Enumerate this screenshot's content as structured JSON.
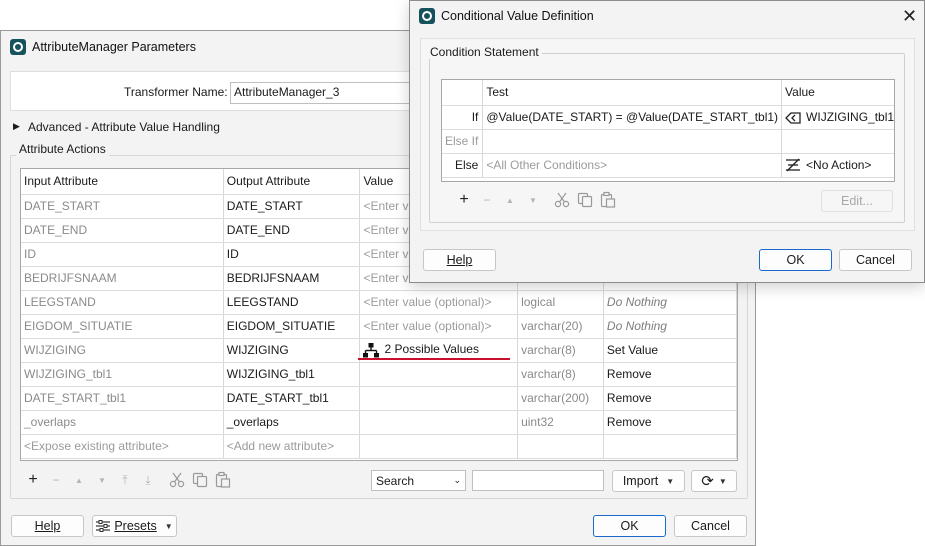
{
  "main_dialog": {
    "title": "AttributeManager Parameters",
    "transformer_name_label": "Transformer Name:",
    "transformer_name_value": "AttributeManager_3",
    "advanced_section": "Advanced - Attribute Value Handling",
    "attribute_actions_label": "Attribute Actions",
    "table": {
      "headers": [
        "Input Attribute",
        "Output Attribute",
        "Value",
        "",
        ""
      ],
      "rows": [
        {
          "input": "DATE_START",
          "output": "DATE_START",
          "value": "<Enter va",
          "type": "",
          "action": ""
        },
        {
          "input": "DATE_END",
          "output": "DATE_END",
          "value": "<Enter va",
          "type": "",
          "action": ""
        },
        {
          "input": "ID",
          "output": "ID",
          "value": "<Enter va",
          "type": "",
          "action": ""
        },
        {
          "input": "BEDRIJFSNAAM",
          "output": "BEDRIJFSNAAM",
          "value": "<Enter va",
          "type": "",
          "action": ""
        },
        {
          "input": "LEEGSTAND",
          "output": "LEEGSTAND",
          "value": "<Enter value (optional)>",
          "type": "logical",
          "action": "Do Nothing"
        },
        {
          "input": "EIGDOM_SITUATIE",
          "output": "EIGDOM_SITUATIE",
          "value": "<Enter value (optional)>",
          "type": "varchar(20)",
          "action": "Do Nothing"
        },
        {
          "input": "WIJZIGING",
          "output": "WIJZIGING",
          "value": "2 Possible Values",
          "type": "varchar(8)",
          "action": "Set Value"
        },
        {
          "input": "WIJZIGING_tbl1",
          "output": "WIJZIGING_tbl1",
          "value": "",
          "type": "varchar(8)",
          "action": "Remove"
        },
        {
          "input": "DATE_START_tbl1",
          "output": "DATE_START_tbl1",
          "value": "",
          "type": "varchar(200)",
          "action": "Remove"
        },
        {
          "input": "_overlaps",
          "output": "_overlaps",
          "value": "",
          "type": "uint32",
          "action": "Remove"
        },
        {
          "input": "<Expose existing attribute>",
          "output": "<Add new attribute>",
          "value": "",
          "type": "",
          "action": ""
        }
      ]
    },
    "toolbar": {
      "add": "+",
      "remove": "−",
      "up": "▲",
      "down": "▼",
      "top": "⤒",
      "bottom": "⤓",
      "search_select": "Search",
      "search_value": "",
      "import_label": "Import",
      "refresh_icon": "⟳"
    },
    "buttons": {
      "help": "Help",
      "presets": "Presets",
      "ok": "OK",
      "cancel": "Cancel"
    }
  },
  "condition_dialog": {
    "title": "Conditional Value Definition",
    "section_label": "Condition Statement",
    "headers": {
      "test": "Test",
      "value": "Value"
    },
    "rows": [
      {
        "label": "If",
        "test": "@Value(DATE_START) = @Value(DATE_START_tbl1)",
        "value": "WIJZIGING_tbl1"
      },
      {
        "label": "Else If",
        "test": "",
        "value": ""
      },
      {
        "label": "Else",
        "test": "<All Other Conditions>",
        "value": "<No Action>"
      }
    ],
    "edit_button": "Edit...",
    "buttons": {
      "help": "Help",
      "ok": "OK",
      "cancel": "Cancel"
    }
  },
  "colors": {
    "accent": "#1b6ac9",
    "highlight_line": "#c8102e",
    "app_icon": "#14535c"
  }
}
